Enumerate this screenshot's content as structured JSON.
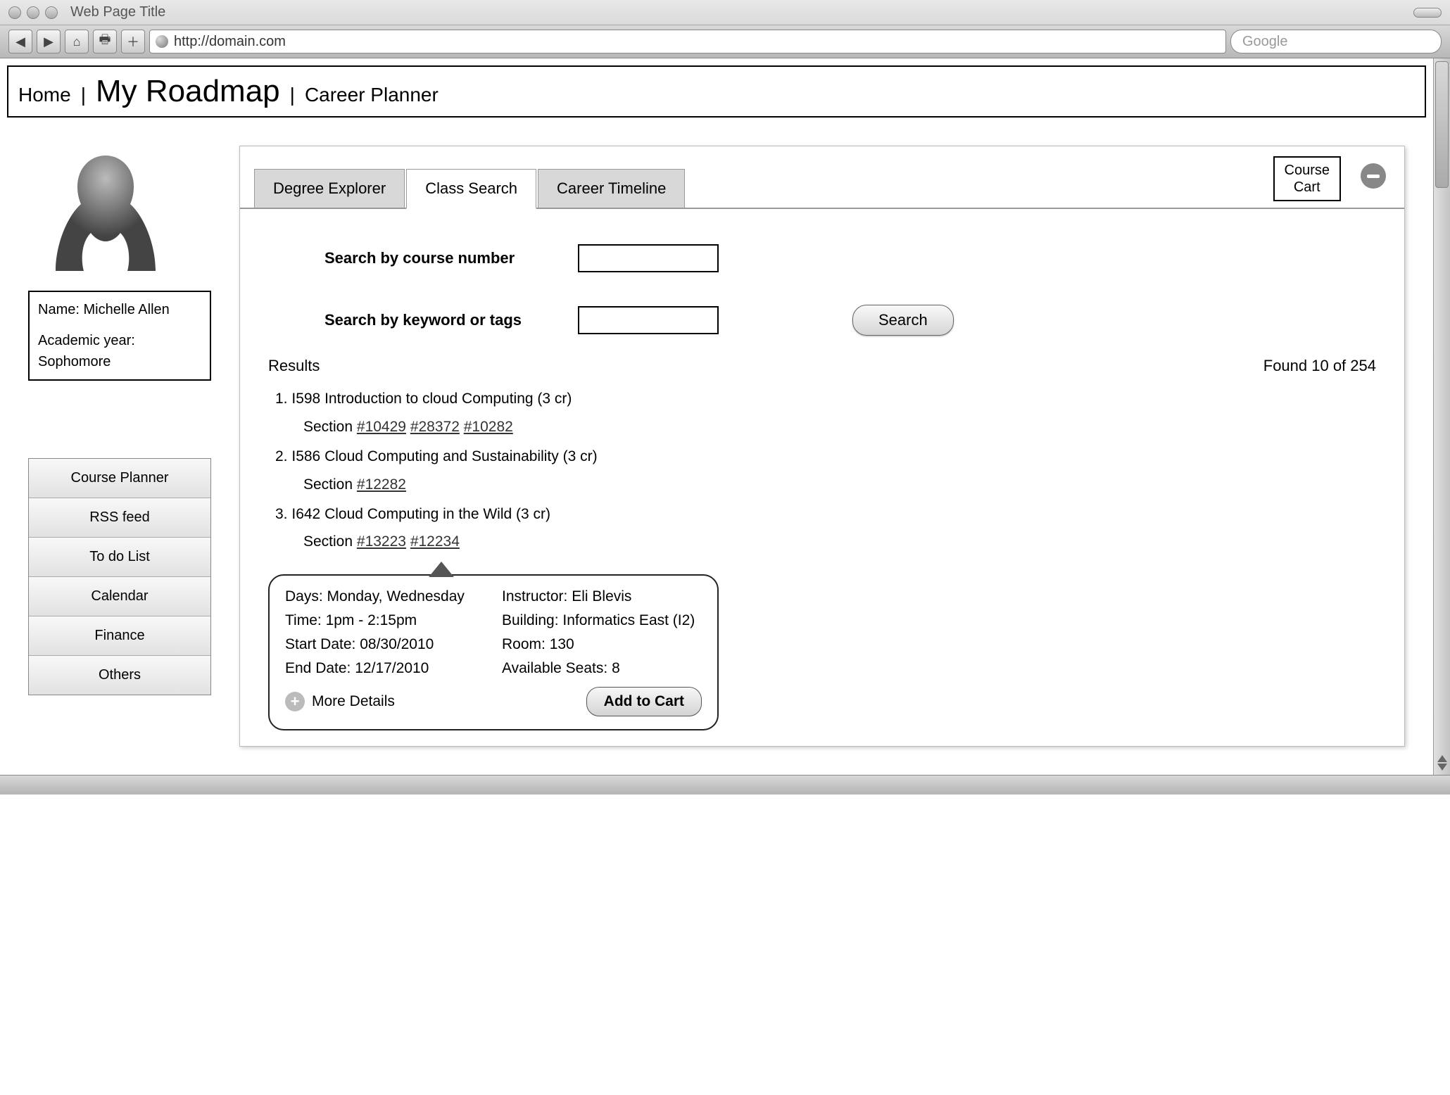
{
  "window": {
    "title": "Web Page Title",
    "url": "http://domain.com",
    "search_placeholder": "Google"
  },
  "breadcrumb": {
    "home": "Home",
    "current": "My Roadmap",
    "other": "Career Planner"
  },
  "profile": {
    "name_label": "Name:",
    "name": "Michelle Allen",
    "year_label": "Academic year:",
    "year": "Sophomore"
  },
  "sidebar": {
    "items": [
      {
        "label": "Course Planner"
      },
      {
        "label": "RSS feed"
      },
      {
        "label": "To do List"
      },
      {
        "label": "Calendar"
      },
      {
        "label": "Finance"
      },
      {
        "label": "Others"
      }
    ]
  },
  "tabs": {
    "items": [
      {
        "label": "Degree  Explorer"
      },
      {
        "label": "Class Search"
      },
      {
        "label": "Career Timeline"
      }
    ],
    "course_cart": "Course\nCart"
  },
  "search": {
    "label_number": "Search by course number",
    "label_keyword": "Search by keyword or tags",
    "button": "Search"
  },
  "results": {
    "heading": "Results",
    "found_text": "Found 10 of 254",
    "section_word": "Section",
    "items": [
      {
        "num": "1.",
        "title": "I598 Introduction to cloud Computing (3 cr)",
        "sections": [
          "#10429",
          "#28372",
          "#10282"
        ]
      },
      {
        "num": "2.",
        "title": "I586 Cloud Computing and Sustainability (3 cr)",
        "sections": [
          "#12282"
        ]
      },
      {
        "num": "3.",
        "title": "I642 Cloud Computing in the Wild (3 cr)",
        "sections": [
          "#13223",
          "#12234"
        ]
      }
    ]
  },
  "popover": {
    "days_label": "Days:",
    "days": "Monday, Wednesday",
    "instructor_label": "Instructor:",
    "instructor": "Eli Blevis",
    "time_label": "Time:",
    "time": "1pm - 2:15pm",
    "building_label": "Building:",
    "building": "Informatics East (I2)",
    "start_label": "Start Date:",
    "start": "08/30/2010",
    "room_label": "Room:",
    "room": "130",
    "end_label": "End Date:",
    "end": "12/17/2010",
    "seats_label": "Available Seats:",
    "seats": "8",
    "more": "More Details",
    "add": "Add to Cart"
  }
}
